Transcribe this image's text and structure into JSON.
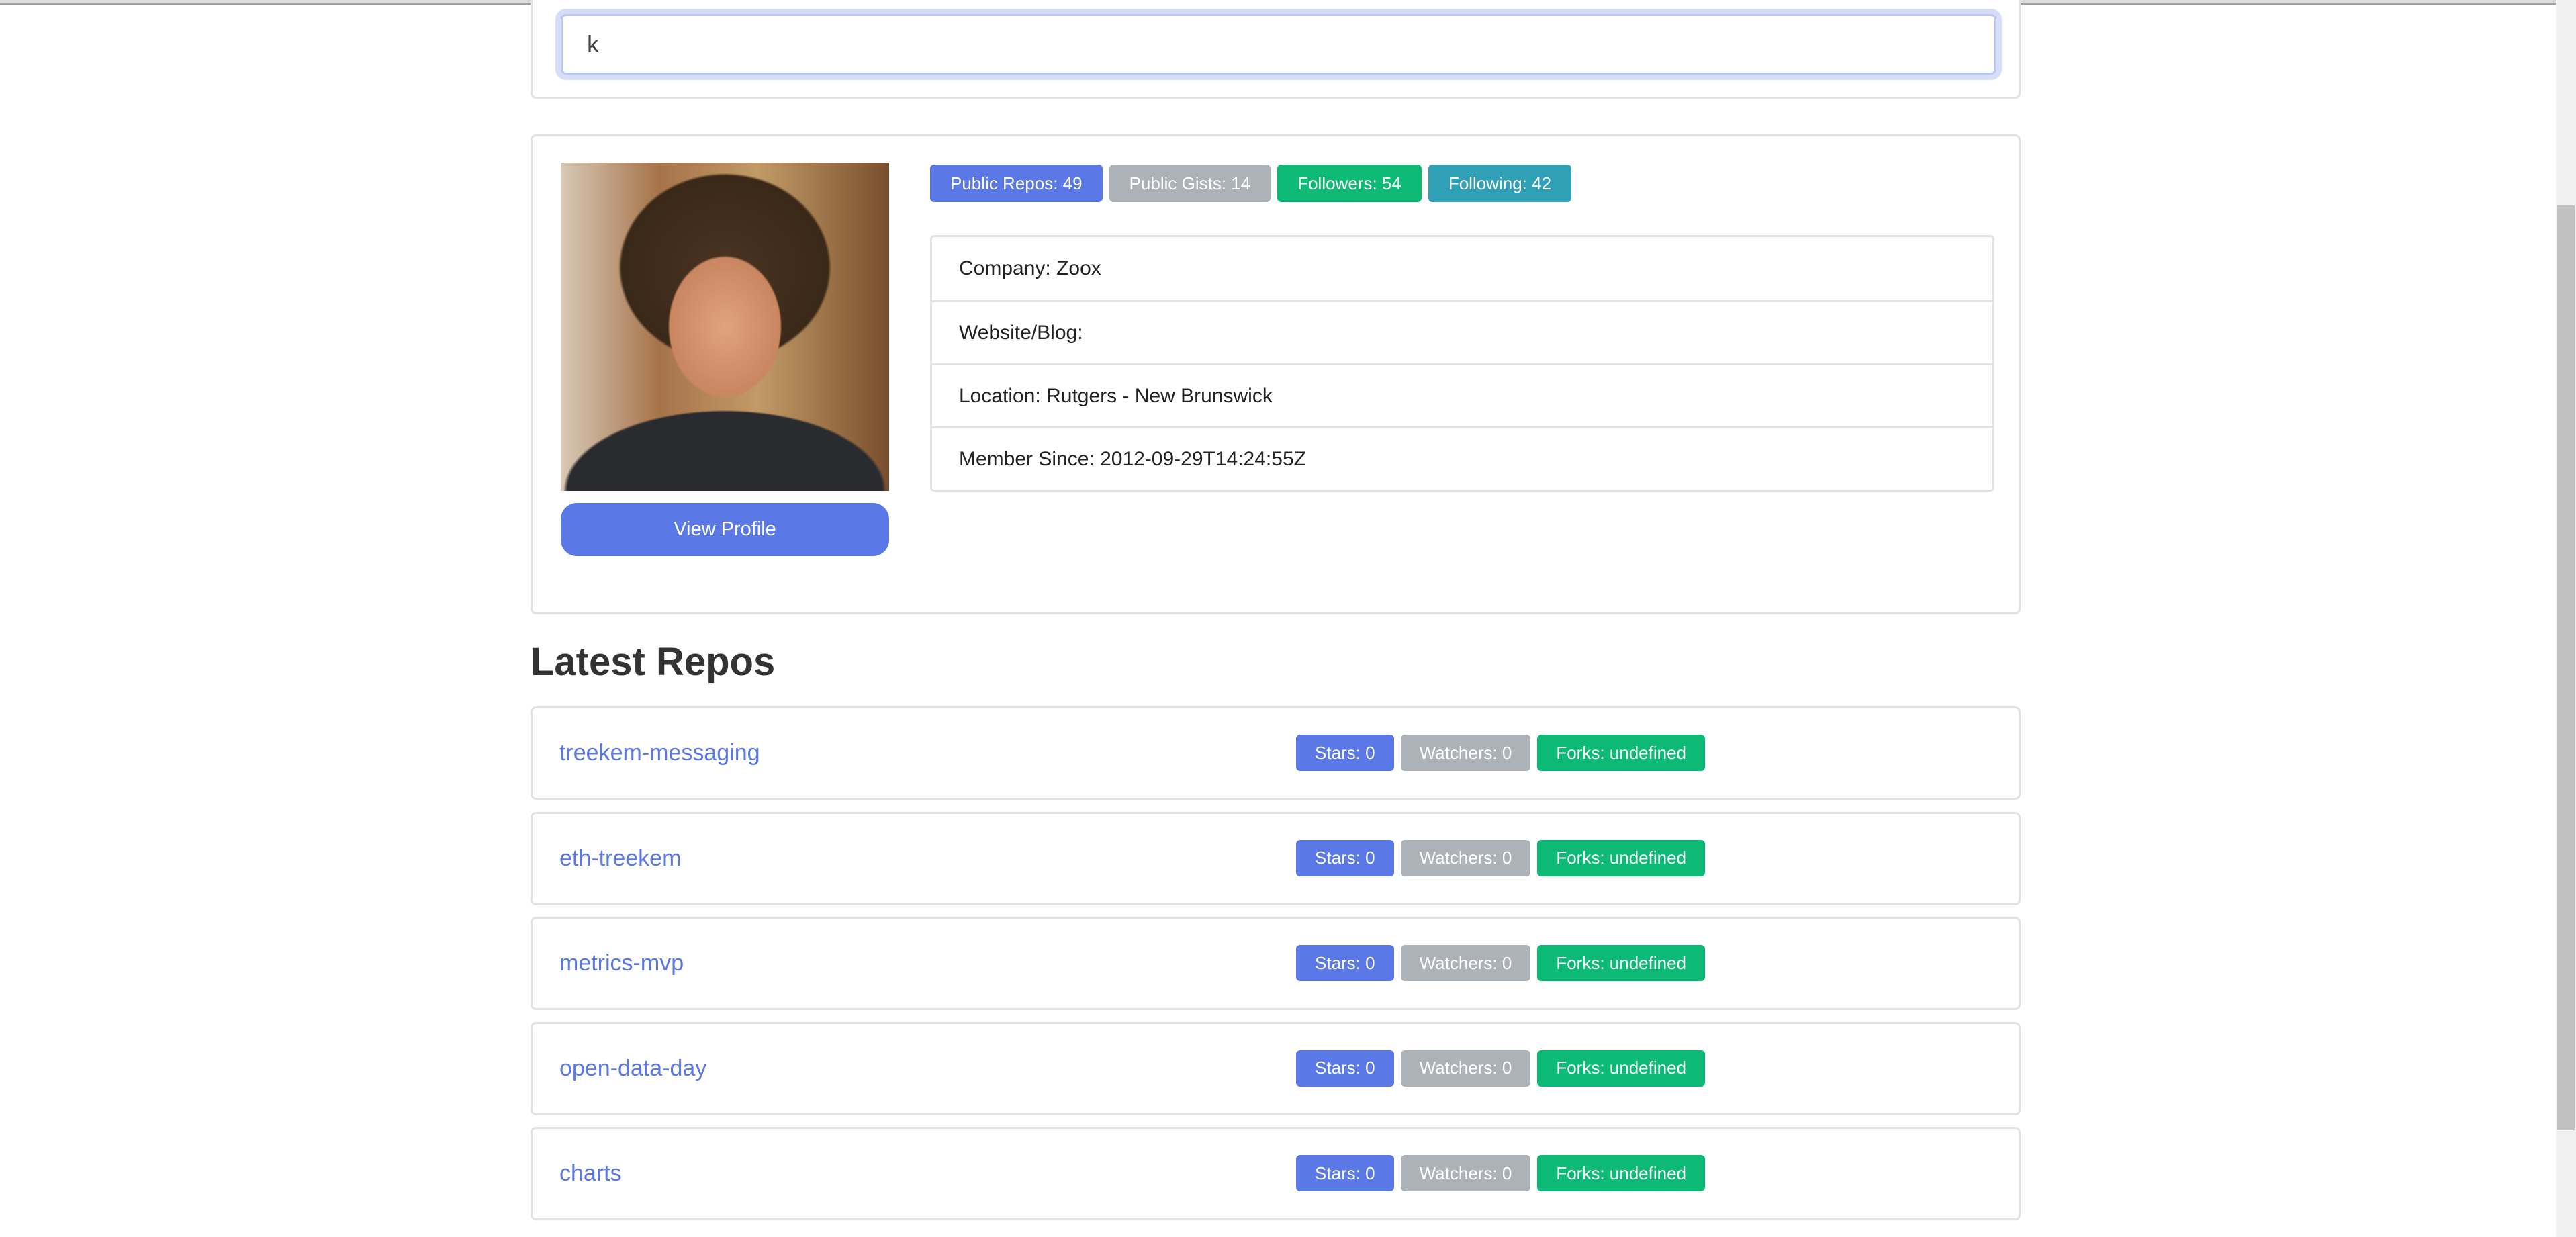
{
  "search": {
    "value": "k"
  },
  "profile": {
    "badges": [
      {
        "label": "Public Repos: 49",
        "color": "#5a78e6"
      },
      {
        "label": "Public Gists: 14",
        "color": "#adb2b9"
      },
      {
        "label": "Followers: 54",
        "color": "#0dba75"
      },
      {
        "label": "Following: 42",
        "color": "#2fa0b5"
      }
    ],
    "details": [
      "Company: Zoox",
      "Website/Blog:",
      "Location: Rutgers - New Brunswick",
      "Member Since: 2012-09-29T14:24:55Z"
    ],
    "view_profile_label": "View Profile"
  },
  "repos_heading": "Latest Repos",
  "repos": [
    {
      "name": "treekem-messaging",
      "stars": "Stars: 0",
      "watchers": "Watchers: 0",
      "forks": "Forks: undefined"
    },
    {
      "name": "eth-treekem",
      "stars": "Stars: 0",
      "watchers": "Watchers: 0",
      "forks": "Forks: undefined"
    },
    {
      "name": "metrics-mvp",
      "stars": "Stars: 0",
      "watchers": "Watchers: 0",
      "forks": "Forks: undefined"
    },
    {
      "name": "open-data-day",
      "stars": "Stars: 0",
      "watchers": "Watchers: 0",
      "forks": "Forks: undefined"
    },
    {
      "name": "charts",
      "stars": "Stars: 0",
      "watchers": "Watchers: 0",
      "forks": "Forks: undefined"
    }
  ],
  "colors": {
    "primary": "#5a78e6",
    "secondary": "#adb2b9",
    "success": "#0dba75",
    "info": "#2fa0b5"
  }
}
